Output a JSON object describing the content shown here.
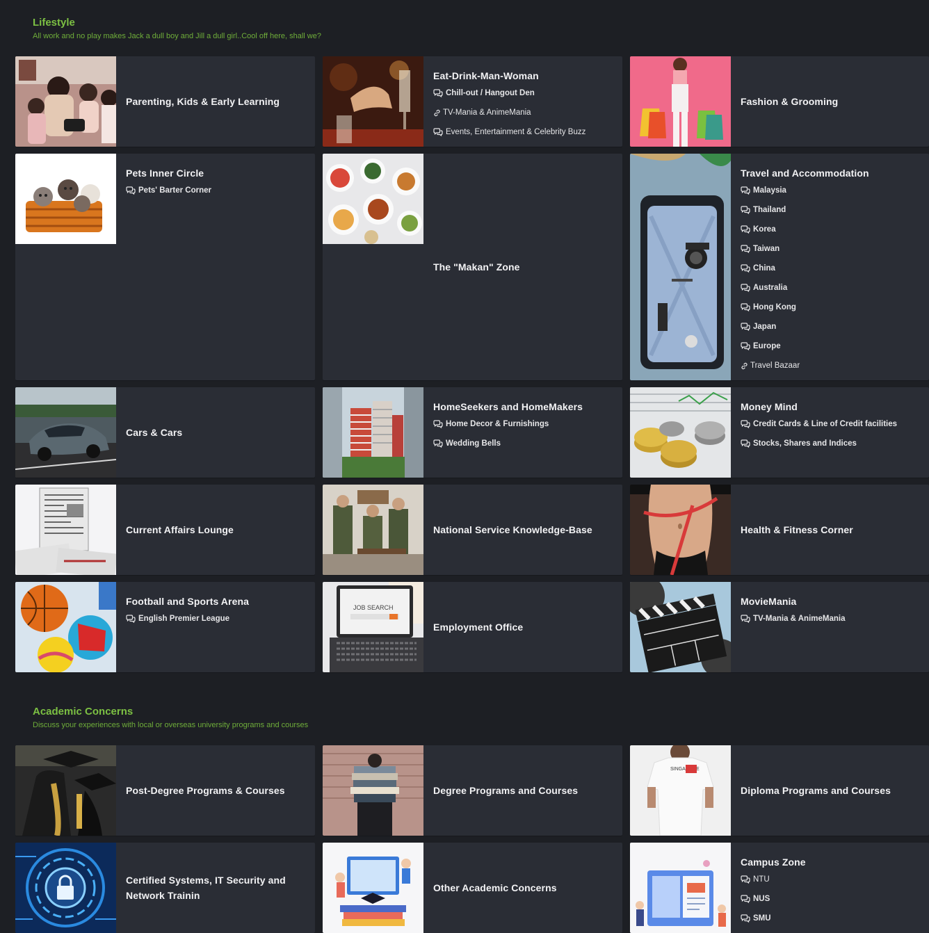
{
  "lifestyle": {
    "title": "Lifestyle",
    "description": "All work and no play makes Jack a dull boy and Jill a dull girl..Cool off here, shall we?",
    "forums": [
      {
        "title": "Parenting, Kids & Early Learning",
        "image": "family-photo",
        "subs": []
      },
      {
        "title": "Eat-Drink-Man-Woman",
        "image": "dining-photo",
        "subs": [
          {
            "label": "Chill-out / Hangout Den",
            "icon": "chat-icon",
            "bold": true
          },
          {
            "label": "TV-Mania & AnimeMania",
            "icon": "link-icon",
            "bold": false
          },
          {
            "label": "Events, Entertainment & Celebrity Buzz",
            "icon": "chat-icon",
            "bold": false
          }
        ]
      },
      {
        "title": "Fashion & Grooming",
        "image": "shopping-photo",
        "subs": []
      },
      {
        "title": "Pets Inner Circle",
        "image": "kittens-photo",
        "subs": [
          {
            "label": "Pets' Barter Corner",
            "icon": "chat-icon",
            "bold": true
          }
        ]
      },
      {
        "title": "The \"Makan\" Zone",
        "image": "food-photo",
        "subs": []
      },
      {
        "title": "Travel and Accommodation",
        "image": "luggage-photo",
        "subs": [
          {
            "label": "Malaysia",
            "icon": "chat-icon",
            "bold": true
          },
          {
            "label": "Thailand",
            "icon": "chat-icon",
            "bold": true
          },
          {
            "label": "Korea",
            "icon": "chat-icon",
            "bold": true
          },
          {
            "label": "Taiwan",
            "icon": "chat-icon",
            "bold": true
          },
          {
            "label": "China",
            "icon": "chat-icon",
            "bold": true
          },
          {
            "label": "Australia",
            "icon": "chat-icon",
            "bold": true
          },
          {
            "label": "Hong Kong",
            "icon": "chat-icon",
            "bold": true
          },
          {
            "label": "Japan",
            "icon": "chat-icon",
            "bold": true
          },
          {
            "label": "Europe",
            "icon": "chat-icon",
            "bold": true
          },
          {
            "label": "Travel Bazaar",
            "icon": "link-icon",
            "bold": false
          }
        ]
      },
      {
        "title": "Cars & Cars",
        "image": "car-photo",
        "subs": []
      },
      {
        "title": "HomeSeekers and HomeMakers",
        "image": "buildings-photo",
        "subs": [
          {
            "label": "Home Decor & Furnishings",
            "icon": "chat-icon",
            "bold": true
          },
          {
            "label": "Wedding Bells",
            "icon": "chat-icon",
            "bold": true
          }
        ]
      },
      {
        "title": "Money Mind",
        "image": "coins-photo",
        "subs": [
          {
            "label": "Credit Cards & Line of Credit facilities",
            "icon": "chat-icon",
            "bold": true
          },
          {
            "label": "Stocks, Shares and Indices",
            "icon": "chat-icon",
            "bold": true
          }
        ]
      },
      {
        "title": "Current Affairs Lounge",
        "image": "newspaper-photo",
        "subs": []
      },
      {
        "title": "National Service Knowledge-Base",
        "image": "soldiers-photo",
        "subs": []
      },
      {
        "title": "Health & Fitness Corner",
        "image": "fitness-photo",
        "subs": []
      },
      {
        "title": "Football and Sports Arena",
        "image": "balls-photo",
        "subs": [
          {
            "label": "English Premier League",
            "icon": "chat-icon",
            "bold": true
          }
        ]
      },
      {
        "title": "Employment Office",
        "image": "job-search-photo",
        "subs": []
      },
      {
        "title": "MovieMania",
        "image": "clapperboard-photo",
        "subs": [
          {
            "label": "TV-Mania & AnimeMania",
            "icon": "chat-icon",
            "bold": true
          }
        ]
      }
    ]
  },
  "academic": {
    "title": "Academic Concerns",
    "description": "Discuss your experiences with local or overseas university programs and courses",
    "forums": [
      {
        "title": "Post-Degree Programs & Courses",
        "image": "graduation-photo",
        "subs": []
      },
      {
        "title": "Degree Programs and Courses",
        "image": "books-photo",
        "subs": []
      },
      {
        "title": "Diploma Programs and Courses",
        "image": "tshirt-photo",
        "subs": []
      },
      {
        "title": "Certified Systems, IT Security and Network Trainin",
        "image": "security-photo",
        "subs": []
      },
      {
        "title": "Other Academic Concerns",
        "image": "study-illustration",
        "subs": []
      },
      {
        "title": "Campus Zone",
        "image": "campus-illustration",
        "subs": [
          {
            "label": "NTU",
            "icon": "chat-icon",
            "bold": false
          },
          {
            "label": "NUS",
            "icon": "chat-icon",
            "bold": true
          },
          {
            "label": "SMU",
            "icon": "chat-icon",
            "bold": true
          }
        ]
      }
    ]
  }
}
